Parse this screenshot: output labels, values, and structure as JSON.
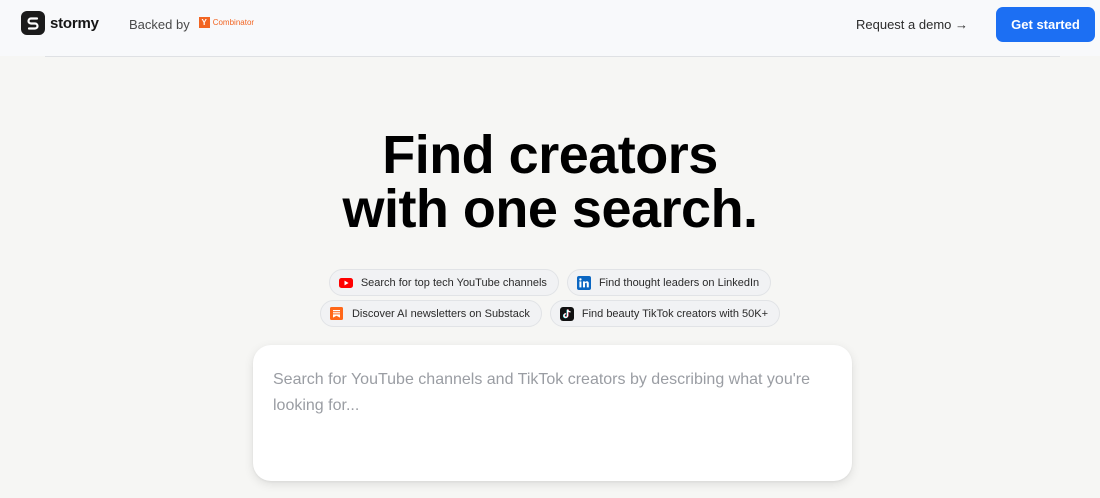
{
  "nav": {
    "brand_name": "stormy",
    "backed_by": "Backed by",
    "yc_letter": "Y",
    "yc_name": "Combinator",
    "demo_link": "Request a demo →",
    "cta": "Get started"
  },
  "hero": {
    "title_line1": "Find creators",
    "title_line2": "with one search."
  },
  "suggestions": [
    {
      "label": "Search for top tech YouTube channels",
      "icon": "youtube-icon"
    },
    {
      "label": "Find thought leaders on LinkedIn",
      "icon": "linkedin-icon"
    },
    {
      "label": "Discover AI newsletters on Substack",
      "icon": "substack-icon"
    },
    {
      "label": "Find beauty TikTok creators with 50K+",
      "icon": "tiktok-icon"
    }
  ],
  "search": {
    "placeholder": "Search for YouTube channels and TikTok creators by describing what you're looking for...",
    "value": ""
  },
  "colors": {
    "accent": "#1c6ff3",
    "yc_orange": "#f26522",
    "youtube_red": "#ff0000",
    "linkedin_blue": "#0a66c2",
    "substack_orange": "#ff6719"
  }
}
